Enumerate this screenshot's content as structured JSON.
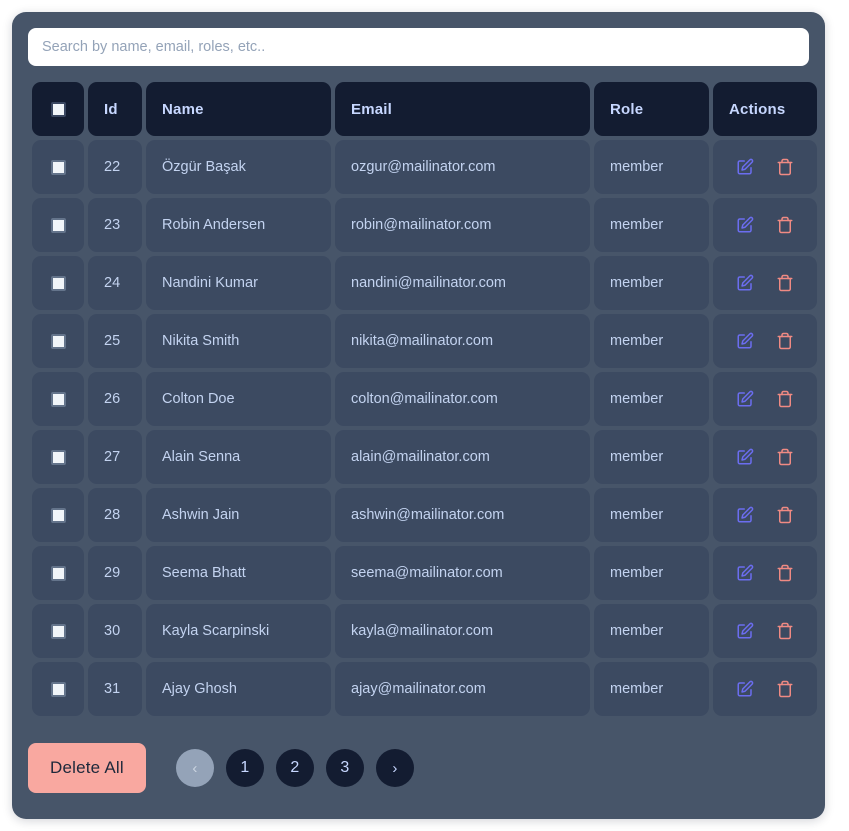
{
  "search": {
    "placeholder": "Search by name, email, roles, etc..",
    "value": ""
  },
  "table": {
    "columns": {
      "select_all": "",
      "id": "Id",
      "name": "Name",
      "email": "Email",
      "role": "Role",
      "actions": "Actions"
    },
    "rows": [
      {
        "id": "22",
        "name": "Özgür Başak",
        "email": "ozgur@mailinator.com",
        "role": "member"
      },
      {
        "id": "23",
        "name": "Robin Andersen",
        "email": "robin@mailinator.com",
        "role": "member"
      },
      {
        "id": "24",
        "name": "Nandini Kumar",
        "email": "nandini@mailinator.com",
        "role": "member"
      },
      {
        "id": "25",
        "name": "Nikita Smith",
        "email": "nikita@mailinator.com",
        "role": "member"
      },
      {
        "id": "26",
        "name": "Colton Doe",
        "email": "colton@mailinator.com",
        "role": "member"
      },
      {
        "id": "27",
        "name": "Alain Senna",
        "email": "alain@mailinator.com",
        "role": "member"
      },
      {
        "id": "28",
        "name": "Ashwin Jain",
        "email": "ashwin@mailinator.com",
        "role": "member"
      },
      {
        "id": "29",
        "name": "Seema Bhatt",
        "email": "seema@mailinator.com",
        "role": "member"
      },
      {
        "id": "30",
        "name": "Kayla Scarpinski",
        "email": "kayla@mailinator.com",
        "role": "member"
      },
      {
        "id": "31",
        "name": "Ajay Ghosh",
        "email": "ajay@mailinator.com",
        "role": "member"
      }
    ],
    "row_icons": {
      "edit": "edit-pencil-square-icon",
      "delete": "trash-icon"
    }
  },
  "footer": {
    "delete_all_label": "Delete All",
    "pagination": {
      "prev_label": "‹",
      "next_label": "›",
      "prev_disabled": true,
      "pages": [
        "1",
        "2",
        "3"
      ],
      "current_page": "1"
    }
  },
  "colors": {
    "page_background": "#ffffff",
    "card_background": "#475569",
    "header_cell": "#131c31",
    "data_cell": "#3c4a61",
    "text_primary": "#c3d3f0",
    "header_text": "#c7d7ff",
    "edit_icon": "#6b6df0",
    "delete_icon": "#f08a83",
    "delete_all_button": "#f9a8a0",
    "pagination_disabled": "#94a3b8"
  }
}
